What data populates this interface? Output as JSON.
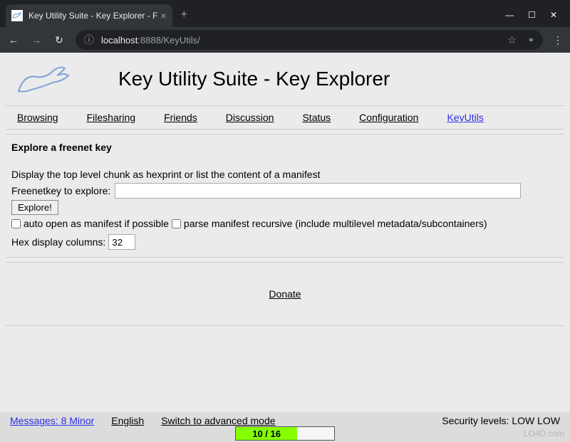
{
  "browser": {
    "tab_title": "Key Utility Suite - Key Explorer - F",
    "url_host": "localhost",
    "url_port": ":8888",
    "url_path": "/KeyUtils/"
  },
  "page": {
    "title": "Key Utility Suite - Key Explorer"
  },
  "nav": {
    "items": [
      {
        "label": "Browsing",
        "active": false
      },
      {
        "label": "Filesharing",
        "active": false
      },
      {
        "label": "Friends",
        "active": false
      },
      {
        "label": "Discussion",
        "active": false
      },
      {
        "label": "Status",
        "active": false
      },
      {
        "label": "Configuration",
        "active": false
      },
      {
        "label": "KeyUtils",
        "active": true
      }
    ]
  },
  "form": {
    "heading": "Explore a freenet key",
    "description": "Display the top level chunk as hexprint or list the content of a manifest",
    "key_label": "Freenetkey to explore:",
    "key_value": "",
    "explore_btn": "Explore!",
    "chk_auto_open": "auto open as manifest if possible",
    "chk_parse_recursive": "parse manifest recursive (include multilevel metadata/subcontainers)",
    "hex_label": "Hex display columns:",
    "hex_value": "32"
  },
  "donate_label": "Donate",
  "status": {
    "messages": "Messages: 8 Minor",
    "language": "English",
    "mode_switch": "Switch to advanced mode",
    "security": "Security levels: LOW  LOW",
    "progress_text": "10 / 16"
  },
  "watermark": "LO4D.com"
}
